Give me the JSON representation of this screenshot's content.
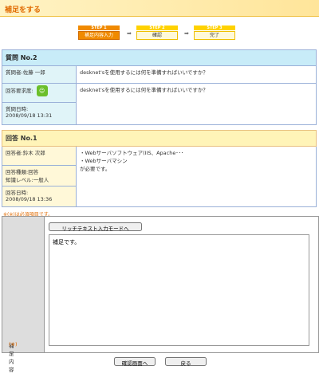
{
  "page": {
    "title": "補足をする"
  },
  "steps": [
    {
      "step": "STEP 1",
      "label": "補足内容入力"
    },
    {
      "step": "STEP 2",
      "label": "確認"
    },
    {
      "step": "STEP 3",
      "label": "完了"
    }
  ],
  "question": {
    "header": "質問 No.2",
    "asker": "質問者:佐藤 一郎",
    "title": "desknet'sを使用するには何を準備すればいいですか？",
    "urgency_label": "回答要求度:",
    "body": "desknet'sを使用するには何を準備すればいいですか？",
    "datetime_label": "質問日時:",
    "datetime": "2008/09/18 13:31"
  },
  "answer": {
    "header": "回答 No.1",
    "responder": "回答者:鈴木 次郎",
    "lines": [
      "・Webサーバソフトウェア(IIS、Apache･･･",
      "・Webサーバマシン",
      "が必要です。"
    ],
    "type_label": "回答種類:回答",
    "level": "知識レベル:一般人",
    "datetime_label": "回答日時:",
    "datetime": "2008/09/18 13:36"
  },
  "form": {
    "required_note": "※(※)は必須項目です。",
    "label": "補足内容",
    "required_mark": "(※)",
    "rich_button": "リッチテキスト入力モードへ",
    "text": "補足です。",
    "confirm_button": "確認画面へ",
    "back_button": "戻る"
  }
}
